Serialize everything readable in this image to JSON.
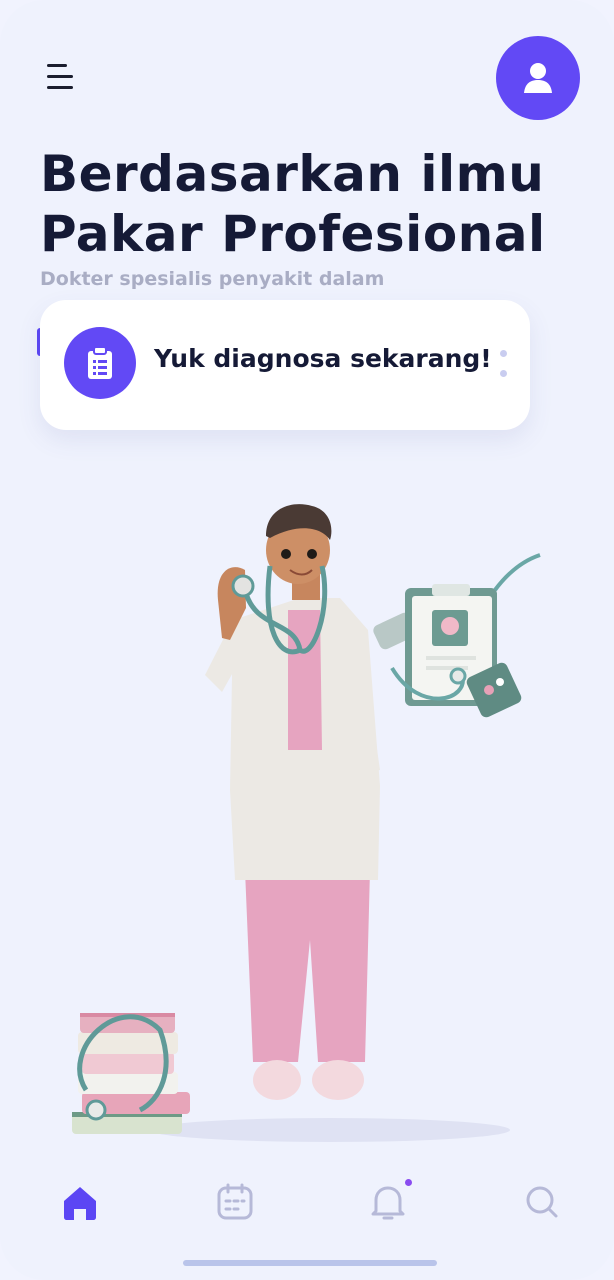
{
  "header": {
    "menu_icon": "hamburger-menu-icon",
    "avatar_icon": "user-icon",
    "avatar_color": "#6249f5"
  },
  "hero": {
    "title_line1": "Berdasarkan ilmu",
    "title_line2": "Pakar Profesional",
    "subtitle": "Dokter spesialis penyakit dalam"
  },
  "cta": {
    "label": "Yuk diagnosa sekarang!",
    "icon": "clipboard-icon",
    "more_icon": "more-vertical-icon"
  },
  "illustration": {
    "subject": "doctor-with-stethoscope",
    "accessories": [
      "stack-of-books",
      "clipboard-with-stethoscope"
    ]
  },
  "tabbar": {
    "active_color": "#5b46f4",
    "inactive_color": "#b6b9d8",
    "tabs": [
      {
        "icon": "home-icon",
        "active": true
      },
      {
        "icon": "calendar-icon",
        "active": false
      },
      {
        "icon": "bell-icon",
        "active": false,
        "has_notification": true
      },
      {
        "icon": "search-icon",
        "active": false
      }
    ]
  }
}
